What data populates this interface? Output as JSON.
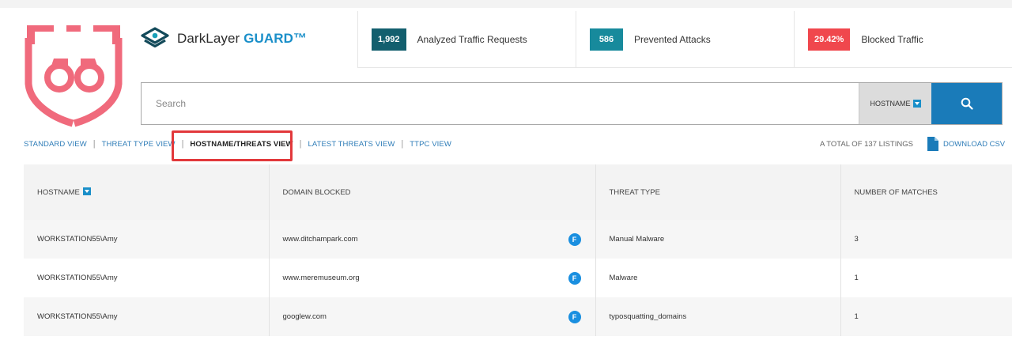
{
  "brand": {
    "name_prefix": "DarkLayer ",
    "name_suffix": "GUARD™",
    "accent_color": "#1a8fc9"
  },
  "stats": [
    {
      "value": "1,992",
      "label": "Analyzed Traffic Requests",
      "color": "#135f6e"
    },
    {
      "value": "586",
      "label": "Prevented Attacks",
      "color": "#178a9c"
    },
    {
      "value": "29.42%",
      "label": "Blocked Traffic",
      "color": "#f0474d"
    }
  ],
  "search": {
    "placeholder": "Search",
    "filter_label": "HOSTNAME",
    "button_icon": "search-icon"
  },
  "views": {
    "items": [
      "STANDARD VIEW",
      "THREAT TYPE VIEW",
      "HOSTNAME/THREATS VIEW",
      "LATEST THREATS VIEW",
      "TTPC VIEW"
    ],
    "active": "HOSTNAME/THREATS VIEW"
  },
  "listing": {
    "total": "A TOTAL OF 137 LISTINGS",
    "download": "DOWNLOAD CSV"
  },
  "table": {
    "headers": [
      "HOSTNAME",
      "DOMAIN BLOCKED",
      "THREAT TYPE",
      "NUMBER OF MATCHES"
    ],
    "rows": [
      {
        "hostname": "WORKSTATION55\\Amy",
        "domain": "www.ditchampark.com",
        "badge": "F",
        "threat": "Manual Malware",
        "matches": "3"
      },
      {
        "hostname": "WORKSTATION55\\Amy",
        "domain": "www.meremuseum.org",
        "badge": "F",
        "threat": "Malware",
        "matches": "1"
      },
      {
        "hostname": "WORKSTATION55\\Amy",
        "domain": "googlew.com",
        "badge": "F",
        "threat": "typosquatting_domains",
        "matches": "1"
      }
    ]
  }
}
